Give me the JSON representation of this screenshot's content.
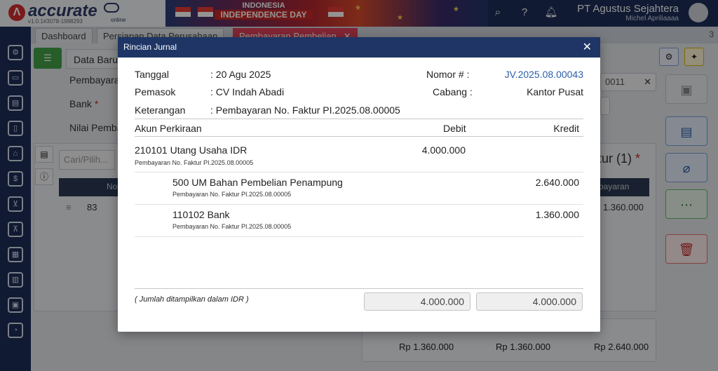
{
  "app": {
    "brand": "accurate",
    "brand_sub": "online",
    "version": "v1.0.1#3078-1998293",
    "banner_line1": "INDONESIA",
    "banner_line2": "INDEPENDENCE DAY",
    "company": "PT Agustus Sejahtera",
    "user": "Michel Apriliaaaa"
  },
  "tabs": [
    {
      "label": "Dashboard"
    },
    {
      "label": "Persiapan Data Perusahaan"
    },
    {
      "label": "Pembayaran Pembelian"
    }
  ],
  "tab_count": "3",
  "background": {
    "form_tab": "Data Baru",
    "label_pembayaran": "Pembayaran",
    "label_bank": "Bank",
    "label_nilai": "Nilai Pemba",
    "field_number_partial": "0011",
    "search_placeholder": "Cari/Pilih...",
    "col_no": "No",
    "col_bayaran": "bayaran",
    "row_no": "83",
    "row_amount": "1.360.000",
    "faktur_title": "ktur (1)",
    "totals": [
      "Rp 1.360.000",
      "Rp 1.360.000",
      "Rp 2.640.000"
    ]
  },
  "modal": {
    "title": "Rincian Jurnal",
    "tanggal_label": "Tanggal",
    "tanggal_value": ": 20 Agu 2025",
    "pemasok_label": "Pemasok",
    "pemasok_value": ": CV Indah Abadi",
    "keterangan_label": "Keterangan",
    "keterangan_value": ": Pembayaran No. Faktur PI.2025.08.00005",
    "nomor_label": "Nomor # :",
    "nomor_value": "JV.2025.08.00043",
    "cabang_label": "Cabang :",
    "cabang_value": "Kantor Pusat",
    "col_akun": "Akun Perkiraan",
    "col_debit": "Debit",
    "col_kredit": "Kredit",
    "rows": [
      {
        "account": "210101 Utang Usaha IDR",
        "note": "Pembayaran No. Faktur PI.2025.08.00005",
        "debit": "4.000.000",
        "kredit": ""
      },
      {
        "account": "500 UM Bahan Pembelian Penampung",
        "note": "Pembayaran No. Faktur PI.2025.08.00005",
        "debit": "",
        "kredit": "2.640.000"
      },
      {
        "account": "110102 Bank",
        "note": "Pembayaran No. Faktur PI.2025.08.00005",
        "debit": "",
        "kredit": "1.360.000"
      }
    ],
    "footer_note": "( Jumlah ditampilkan dalam IDR )",
    "total_debit": "4.000.000",
    "total_kredit": "4.000.000"
  }
}
